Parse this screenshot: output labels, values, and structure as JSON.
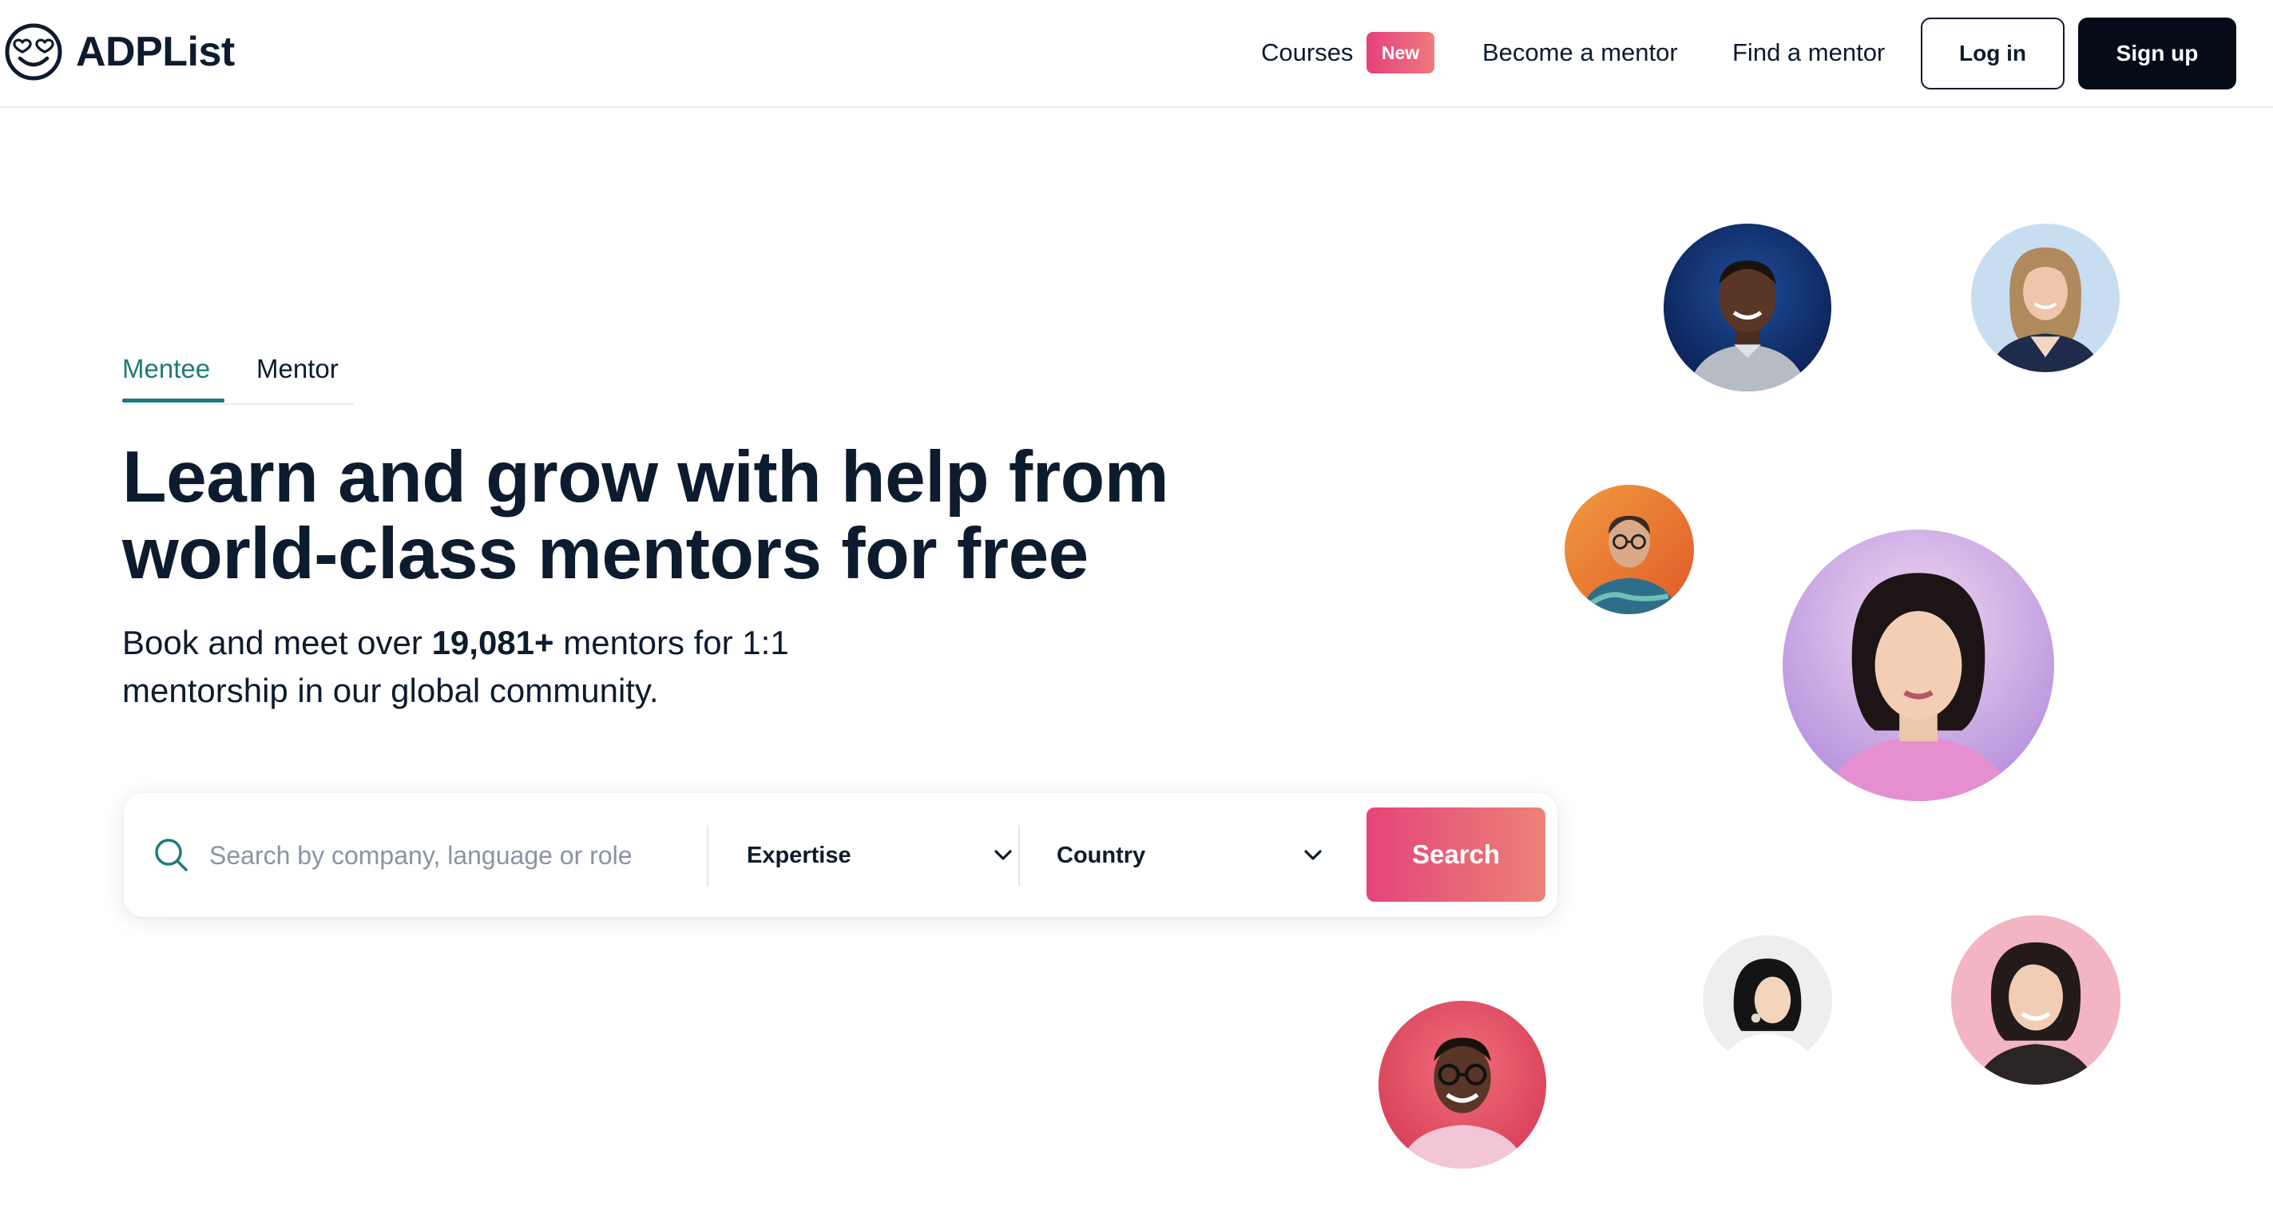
{
  "brand": {
    "name": "ADPList",
    "logo_icon": "smiley-heart-eyes-icon"
  },
  "nav": {
    "courses": "Courses",
    "courses_badge": "New",
    "become_mentor": "Become a mentor",
    "find_mentor": "Find a mentor",
    "login": "Log in",
    "signup": "Sign up"
  },
  "tabs": [
    {
      "label": "Mentee",
      "active": true
    },
    {
      "label": "Mentor",
      "active": false
    }
  ],
  "hero": {
    "headline_line1": "Learn and grow with help from",
    "headline_line2": "world-class mentors for free",
    "sub_prefix": "Book and meet over ",
    "sub_count": "19,081+",
    "sub_suffix_line1": " mentors for 1:1",
    "sub_line2": "mentorship in our global community."
  },
  "search": {
    "placeholder": "Search by company, language or role",
    "expertise_label": "Expertise",
    "country_label": "Country",
    "button_label": "Search",
    "icon": "search-icon"
  },
  "colors": {
    "primary_text": "#0d1b2e",
    "accent_teal": "#1f7a7a",
    "gradient_start": "#e44479",
    "gradient_end": "#ec8278",
    "signup_bg": "#060b18"
  },
  "mentor_avatars": [
    "mentor-avatar-1",
    "mentor-avatar-2",
    "mentor-avatar-3",
    "mentor-avatar-4",
    "mentor-avatar-5",
    "mentor-avatar-6",
    "mentor-avatar-7"
  ]
}
